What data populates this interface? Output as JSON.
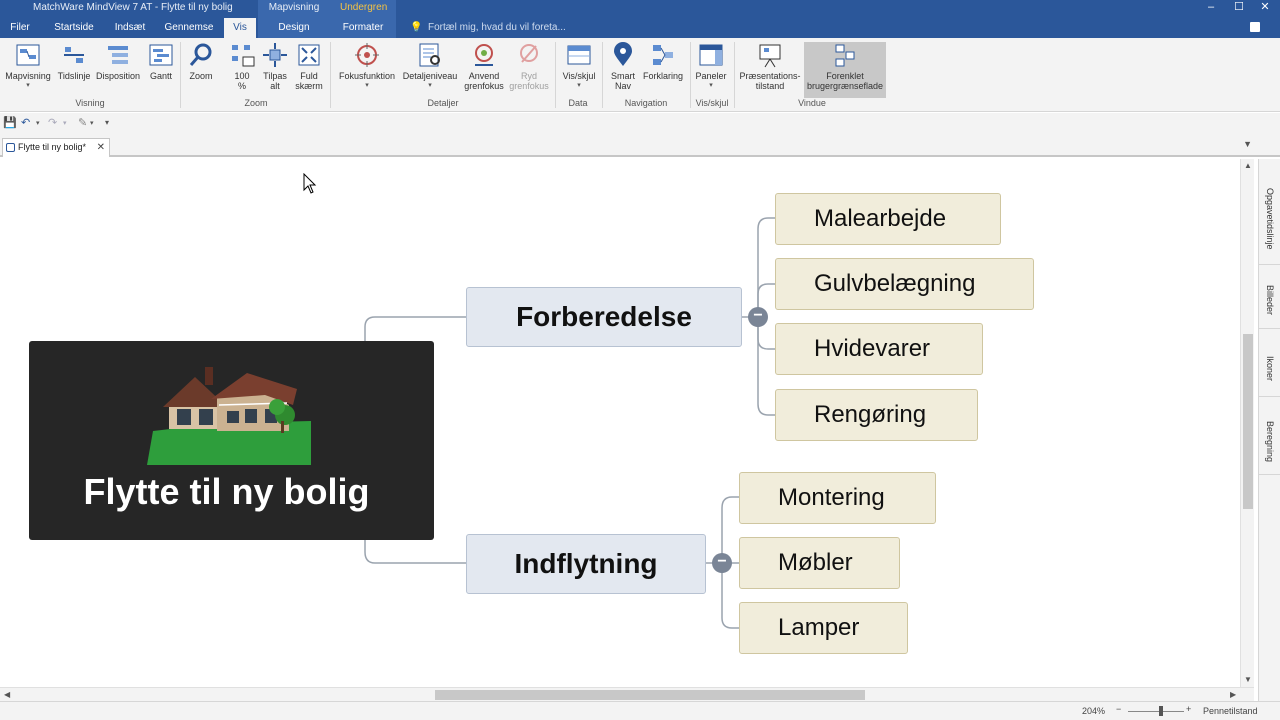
{
  "window": {
    "title": "MatchWare MindView 7 AT - Flytte til ny bolig",
    "context_tab_map": "Mapvisning",
    "context_tab_sub": "Undergren",
    "min": "–",
    "max": "☐",
    "close": "✕"
  },
  "tabs": {
    "filer": "Filer",
    "startside": "Startside",
    "indsaet": "Indsæt",
    "gennemse": "Gennemse",
    "vis": "Vis",
    "design": "Design",
    "formater": "Formater",
    "tellme": "Fortæl mig, hvad du vil foreta..."
  },
  "ribbon": {
    "mapvisning": "Mapvisning",
    "tidslinje": "Tidslinje",
    "disposition": "Disposition",
    "gantt": "Gantt",
    "group_visning": "Visning",
    "zoom": "Zoom",
    "pct100_a": "100",
    "pct100_b": "%",
    "tilpas_a": "Tilpas",
    "tilpas_b": "alt",
    "fuld_a": "Fuld",
    "fuld_b": "skærm",
    "group_zoom": "Zoom",
    "fokusfunktion": "Fokusfunktion",
    "detaljeniveau": "Detaljeniveau",
    "anvend_a": "Anvend",
    "anvend_b": "grenfokus",
    "ryd_a": "Ryd",
    "ryd_b": "grenfokus",
    "group_detaljer": "Detaljer",
    "visskjul": "Vis/skjul",
    "group_data": "Data",
    "smart_a": "Smart",
    "smart_b": "Nav",
    "forklaring": "Forklaring",
    "group_navigation": "Navigation",
    "paneler": "Paneler",
    "group_visskjul": "Vis/skjul",
    "praes_a": "Præsentations-",
    "praes_b": "tilstand",
    "forenklet_a": "Forenklet",
    "forenklet_b": "brugergrænseflade",
    "group_vindue": "Vindue"
  },
  "document": {
    "tab_label": "Flytte til ny bolig*",
    "close": "✕"
  },
  "map": {
    "central": "Flytte til ny bolig",
    "branches": [
      {
        "label": "Forberedelse",
        "children": [
          "Malearbejde",
          "Gulvbelægning",
          "Hvidevarer",
          "Rengøring"
        ]
      },
      {
        "label": "Indflytning",
        "children": [
          "Montering",
          "Møbler",
          "Lamper"
        ]
      }
    ]
  },
  "side_panels": [
    "Opgavetidslinje",
    "Billeder",
    "Ikoner",
    "Beregning"
  ],
  "status": {
    "zoom": "204%",
    "minus": "−",
    "plus": "+",
    "fit": "Pennetilstand"
  },
  "colors": {
    "accent": "#2b579a",
    "central_bg": "#262626",
    "main_topic_bg": "#e3e8f0",
    "sub_topic_bg": "#f1eddb"
  }
}
